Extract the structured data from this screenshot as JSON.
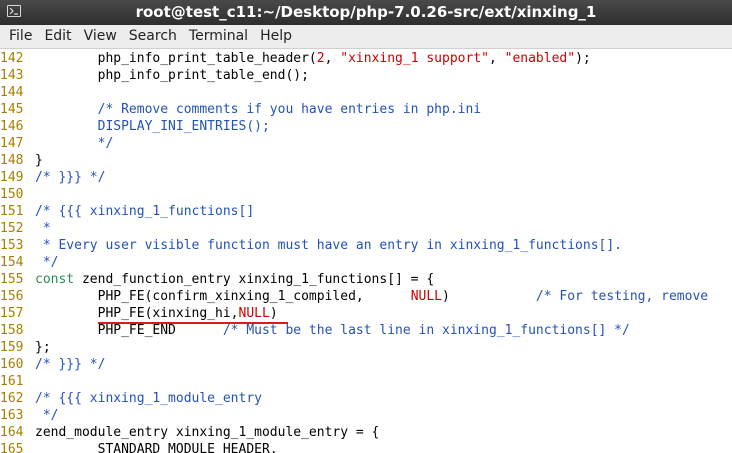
{
  "window": {
    "title": "root@test_c11:~/Desktop/php-7.0.26-src/ext/xinxing_1",
    "icon": "terminal-icon"
  },
  "menu": [
    "File",
    "Edit",
    "View",
    "Search",
    "Terminal",
    "Help"
  ],
  "colors": {
    "line_number": "#a67f00",
    "comment": "#2452b7",
    "string": "#cc0000",
    "keyword": "#2e8b57",
    "highlight_underline": "#d81b1b"
  },
  "lines": [
    {
      "n": "142",
      "segs": [
        [
          "code",
          "        php_info_print_table_header("
        ],
        [
          "num",
          "2"
        ],
        [
          "code",
          ", "
        ],
        [
          "str",
          "\"xinxing_1 support\""
        ],
        [
          "code",
          ", "
        ],
        [
          "str",
          "\"enabled\""
        ],
        [
          "code",
          ");"
        ]
      ]
    },
    {
      "n": "143",
      "segs": [
        [
          "code",
          "        php_info_print_table_end();"
        ]
      ]
    },
    {
      "n": "144",
      "segs": []
    },
    {
      "n": "145",
      "segs": [
        [
          "cmt",
          "        /* Remove comments if you have entries in php.ini"
        ]
      ]
    },
    {
      "n": "146",
      "segs": [
        [
          "cmt",
          "        DISPLAY_INI_ENTRIES();"
        ]
      ]
    },
    {
      "n": "147",
      "segs": [
        [
          "cmt",
          "        */"
        ]
      ]
    },
    {
      "n": "148",
      "segs": [
        [
          "code",
          "}"
        ]
      ]
    },
    {
      "n": "149",
      "segs": [
        [
          "cmt",
          "/* }}} */"
        ]
      ]
    },
    {
      "n": "150",
      "segs": []
    },
    {
      "n": "151",
      "segs": [
        [
          "cmt",
          "/* {{{ xinxing_1_functions[]"
        ]
      ]
    },
    {
      "n": "152",
      "segs": [
        [
          "cmt",
          " *"
        ]
      ]
    },
    {
      "n": "153",
      "segs": [
        [
          "cmt",
          " * Every user visible function must have an entry in xinxing_1_functions[]."
        ]
      ]
    },
    {
      "n": "154",
      "segs": [
        [
          "cmt",
          " */"
        ]
      ]
    },
    {
      "n": "155",
      "segs": [
        [
          "kw",
          "const"
        ],
        [
          "code",
          " zend_function_entry xinxing_1_functions[] = {"
        ]
      ]
    },
    {
      "n": "156",
      "segs": [
        [
          "code",
          "        PHP_FE(confirm_xinxing_1_compiled,      "
        ],
        [
          "null",
          "NULL"
        ],
        [
          "code",
          ")           "
        ],
        [
          "cmt",
          "/* For testing, remove"
        ]
      ]
    },
    {
      "n": "157",
      "segs": [
        [
          "code",
          "        PHP_FE(xinxing_hi,"
        ],
        [
          "null",
          "NULL"
        ],
        [
          "code",
          ")"
        ]
      ]
    },
    {
      "n": "158",
      "segs": [
        [
          "code",
          "        PHP_FE_END      "
        ],
        [
          "cmt",
          "/* Must be the last line in xinxing_1_functions[] */"
        ]
      ]
    },
    {
      "n": "159",
      "segs": [
        [
          "code",
          "};"
        ]
      ]
    },
    {
      "n": "160",
      "segs": [
        [
          "cmt",
          "/* }}} */"
        ]
      ]
    },
    {
      "n": "161",
      "segs": []
    },
    {
      "n": "162",
      "segs": [
        [
          "cmt",
          "/* {{{ xinxing_1_module_entry"
        ]
      ]
    },
    {
      "n": "163",
      "segs": [
        [
          "cmt",
          " */"
        ]
      ]
    },
    {
      "n": "164",
      "segs": [
        [
          "code",
          "zend_module_entry xinxing_1_module_entry = {"
        ]
      ]
    },
    {
      "n": "165",
      "segs": [
        [
          "code",
          "        STANDARD_MODULE_HEADER,"
        ]
      ]
    }
  ]
}
